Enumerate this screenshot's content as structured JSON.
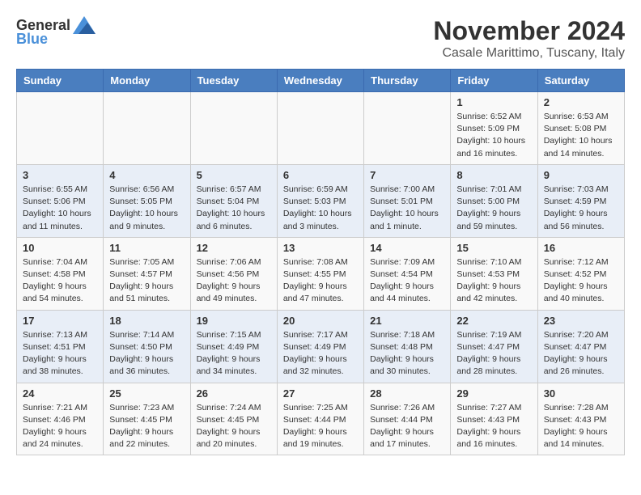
{
  "logo": {
    "general": "General",
    "blue": "Blue"
  },
  "title": {
    "month": "November 2024",
    "location": "Casale Marittimo, Tuscany, Italy"
  },
  "headers": [
    "Sunday",
    "Monday",
    "Tuesday",
    "Wednesday",
    "Thursday",
    "Friday",
    "Saturday"
  ],
  "weeks": [
    [
      {
        "day": "",
        "info": ""
      },
      {
        "day": "",
        "info": ""
      },
      {
        "day": "",
        "info": ""
      },
      {
        "day": "",
        "info": ""
      },
      {
        "day": "",
        "info": ""
      },
      {
        "day": "1",
        "info": "Sunrise: 6:52 AM\nSunset: 5:09 PM\nDaylight: 10 hours and 16 minutes."
      },
      {
        "day": "2",
        "info": "Sunrise: 6:53 AM\nSunset: 5:08 PM\nDaylight: 10 hours and 14 minutes."
      }
    ],
    [
      {
        "day": "3",
        "info": "Sunrise: 6:55 AM\nSunset: 5:06 PM\nDaylight: 10 hours and 11 minutes."
      },
      {
        "day": "4",
        "info": "Sunrise: 6:56 AM\nSunset: 5:05 PM\nDaylight: 10 hours and 9 minutes."
      },
      {
        "day": "5",
        "info": "Sunrise: 6:57 AM\nSunset: 5:04 PM\nDaylight: 10 hours and 6 minutes."
      },
      {
        "day": "6",
        "info": "Sunrise: 6:59 AM\nSunset: 5:03 PM\nDaylight: 10 hours and 3 minutes."
      },
      {
        "day": "7",
        "info": "Sunrise: 7:00 AM\nSunset: 5:01 PM\nDaylight: 10 hours and 1 minute."
      },
      {
        "day": "8",
        "info": "Sunrise: 7:01 AM\nSunset: 5:00 PM\nDaylight: 9 hours and 59 minutes."
      },
      {
        "day": "9",
        "info": "Sunrise: 7:03 AM\nSunset: 4:59 PM\nDaylight: 9 hours and 56 minutes."
      }
    ],
    [
      {
        "day": "10",
        "info": "Sunrise: 7:04 AM\nSunset: 4:58 PM\nDaylight: 9 hours and 54 minutes."
      },
      {
        "day": "11",
        "info": "Sunrise: 7:05 AM\nSunset: 4:57 PM\nDaylight: 9 hours and 51 minutes."
      },
      {
        "day": "12",
        "info": "Sunrise: 7:06 AM\nSunset: 4:56 PM\nDaylight: 9 hours and 49 minutes."
      },
      {
        "day": "13",
        "info": "Sunrise: 7:08 AM\nSunset: 4:55 PM\nDaylight: 9 hours and 47 minutes."
      },
      {
        "day": "14",
        "info": "Sunrise: 7:09 AM\nSunset: 4:54 PM\nDaylight: 9 hours and 44 minutes."
      },
      {
        "day": "15",
        "info": "Sunrise: 7:10 AM\nSunset: 4:53 PM\nDaylight: 9 hours and 42 minutes."
      },
      {
        "day": "16",
        "info": "Sunrise: 7:12 AM\nSunset: 4:52 PM\nDaylight: 9 hours and 40 minutes."
      }
    ],
    [
      {
        "day": "17",
        "info": "Sunrise: 7:13 AM\nSunset: 4:51 PM\nDaylight: 9 hours and 38 minutes."
      },
      {
        "day": "18",
        "info": "Sunrise: 7:14 AM\nSunset: 4:50 PM\nDaylight: 9 hours and 36 minutes."
      },
      {
        "day": "19",
        "info": "Sunrise: 7:15 AM\nSunset: 4:49 PM\nDaylight: 9 hours and 34 minutes."
      },
      {
        "day": "20",
        "info": "Sunrise: 7:17 AM\nSunset: 4:49 PM\nDaylight: 9 hours and 32 minutes."
      },
      {
        "day": "21",
        "info": "Sunrise: 7:18 AM\nSunset: 4:48 PM\nDaylight: 9 hours and 30 minutes."
      },
      {
        "day": "22",
        "info": "Sunrise: 7:19 AM\nSunset: 4:47 PM\nDaylight: 9 hours and 28 minutes."
      },
      {
        "day": "23",
        "info": "Sunrise: 7:20 AM\nSunset: 4:47 PM\nDaylight: 9 hours and 26 minutes."
      }
    ],
    [
      {
        "day": "24",
        "info": "Sunrise: 7:21 AM\nSunset: 4:46 PM\nDaylight: 9 hours and 24 minutes."
      },
      {
        "day": "25",
        "info": "Sunrise: 7:23 AM\nSunset: 4:45 PM\nDaylight: 9 hours and 22 minutes."
      },
      {
        "day": "26",
        "info": "Sunrise: 7:24 AM\nSunset: 4:45 PM\nDaylight: 9 hours and 20 minutes."
      },
      {
        "day": "27",
        "info": "Sunrise: 7:25 AM\nSunset: 4:44 PM\nDaylight: 9 hours and 19 minutes."
      },
      {
        "day": "28",
        "info": "Sunrise: 7:26 AM\nSunset: 4:44 PM\nDaylight: 9 hours and 17 minutes."
      },
      {
        "day": "29",
        "info": "Sunrise: 7:27 AM\nSunset: 4:43 PM\nDaylight: 9 hours and 16 minutes."
      },
      {
        "day": "30",
        "info": "Sunrise: 7:28 AM\nSunset: 4:43 PM\nDaylight: 9 hours and 14 minutes."
      }
    ]
  ]
}
